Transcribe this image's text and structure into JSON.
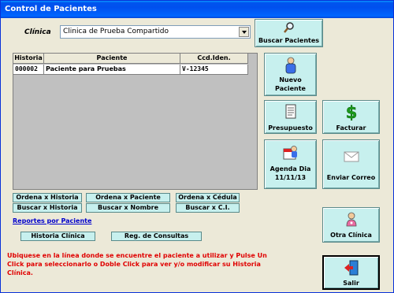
{
  "window": {
    "title": "Control de Pacientes"
  },
  "clinic": {
    "label": "Clínica",
    "selected": "Clinica de Prueba Compartido"
  },
  "table": {
    "headers": [
      "Historia",
      "Paciente",
      "Ccd.Iden."
    ],
    "rows": [
      [
        "000002",
        "Paciente para Pruebas",
        "V-12345"
      ]
    ]
  },
  "buttons": {
    "buscar_pacientes": "Buscar Pacientes",
    "nuevo_paciente_l1": "Nuevo",
    "nuevo_paciente_l2": "Paciente",
    "presupuesto": "Presupuesto",
    "facturar": "Facturar",
    "agenda_l1": "Agenda Dia",
    "agenda_l2": "11/11/13",
    "enviar_correo": "Enviar Correo",
    "otra_clinica": "Otra Clínica",
    "salir": "Salir"
  },
  "sort_buttons": {
    "ordena_historia": "Ordena x Historia",
    "ordena_paciente": "Ordena x Paciente",
    "ordena_cedula": "Ordena x Cédula",
    "buscar_historia": "Buscar x Historia",
    "buscar_nombre": "Buscar x Nombre",
    "buscar_ci": "Buscar x C.I."
  },
  "reports": {
    "link": "Reportes por Paciente",
    "historia_clinica": "Historia Clínica",
    "reg_consultas": "Reg. de Consultas"
  },
  "notice": "Ubiquese en la línea donde se encuentre el paciente a utilizar y Pulse Un Click para seleccionarlo o Doble Click para ver y/o modificar su Historia Clínica."
}
